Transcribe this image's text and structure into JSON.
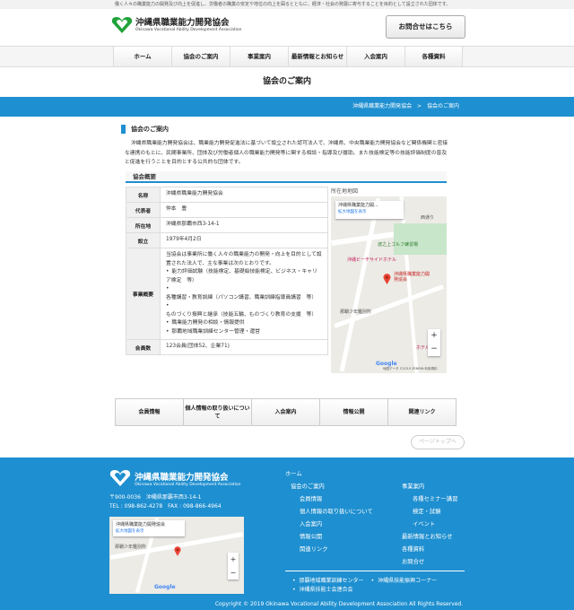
{
  "topbar": {
    "text": "働く人々の職業能力の開発及び向上を促進し、労働者の職業の安定や地位の向上を図るとともに、経済・社会の発展に寄与することを目的として設立された団体です。"
  },
  "header": {
    "logo_name": "沖縄県職業能力開発協会",
    "logo_sub": "Okinawa Vocational Ability Development Association",
    "contact_button": "お問合せはこちら"
  },
  "nav": {
    "items": [
      "ホーム",
      "協会のご案内",
      "事業案内",
      "最新情報とお知らせ",
      "入会案内",
      "各種資料"
    ]
  },
  "page": {
    "title": "協会のご案内"
  },
  "breadcrumb": {
    "parent": "沖縄県職業能力開発協会",
    "separator": ">",
    "current": "協会のご案内"
  },
  "section": {
    "heading": "協会のご案内",
    "intro": "沖縄県職業能力開発協会は、職業能力開発促進法に基づいて設立された認可法人で、沖縄県、中央職業能力開発協会など関係機関と密接な連携のもとに、民間事業所、団体及び労働者個人の職業能力開発等に関する相談・指導及び援助、また技能検定等の技能評価制度の普及と促進を行うことを目的とする公共的な団体です。",
    "summary_heading": "協会概要",
    "map_label": "所在地地図"
  },
  "table": {
    "name_label": "名称",
    "name_value": "沖縄県職業能力開発協会",
    "rep_label": "代表者",
    "rep_value": "仲本　豊",
    "addr_label": "所在地",
    "addr_value": "沖縄県那覇市西3-14-1",
    "est_label": "設立",
    "est_value": "1979年4月2日",
    "biz_label": "事業概要",
    "biz_intro": "当協会は事業所に働く人々の職業能力の開発・向上を目的として設置された法人で、主な事業は次のとおりです。",
    "biz_items": [
      "能力評価試験（技能検定、基礎級技能検定、ビジネス・キャリア検定　等）",
      "各種講習・教育訓練（パソコン講習、職業訓練指導員講習　等）",
      "ものづくり振興と継承（技能五輪、ものづくり教育の支援　等）",
      "職業能力開発の相談・情報提供",
      "那覇地域職業訓練センター管理・運営"
    ],
    "members_label": "会員数",
    "members_value": "123会員(団体52、企業71)"
  },
  "map": {
    "place": "沖縄県職業能力開...",
    "enlarge": "拡大地図を表示",
    "pin_label": "沖縄県職業能力開発協会",
    "labels": [
      "西通り",
      "沖縄ビーチサイドホテル",
      "波之上ゴルフ練習場",
      "那覇少年鑑別所",
      "ホテル"
    ],
    "google": "Google",
    "credits": "地図データ ©2019 ZENRIN 利用規約",
    "zoom_in": "+",
    "zoom_out": "−"
  },
  "bottom_buttons": [
    "会員情報",
    "個人情報の取り扱いについて",
    "入会案内",
    "情報公開",
    "関連リンク"
  ],
  "pagetop": "ページトップへ",
  "footer": {
    "logo_name": "沖縄県職業能力開発協会",
    "logo_sub": "Okinawa Vocational Ability Development Association",
    "postal": "〒900-0036　沖縄県那覇市西3-14-1",
    "tel_fax": "TEL : 098-862-4278　FAX : 098-866-4964",
    "map_place": "沖縄県職業能力開発協会",
    "map_enlarge": "拡大地図を表示",
    "map_label": "那覇少年鑑別所",
    "col1": [
      "ホーム",
      "協会のご案内",
      "会員情報",
      "個人情報の取り扱いについて",
      "入会案内",
      "情報公開",
      "関連リンク"
    ],
    "col2": [
      "事業案内",
      "各種セミナー講習",
      "検定・試験",
      "イベント",
      "最新情報とお知らせ",
      "各種資料",
      "お問合せ"
    ],
    "links": [
      "那覇地域職業訓練センター",
      "沖縄県技能振興コーナー",
      "沖縄県技能士会連合会"
    ],
    "copyright": "Copyright © 2019 Okinawa Vocational Ability Development Association All Rights Reserved."
  },
  "colors": {
    "accent": "#1e8fd0",
    "logo_green": "#21a33a"
  },
  "icons": {
    "logo": "heart-hands-logo-icon",
    "pin": "map-pin-icon"
  }
}
